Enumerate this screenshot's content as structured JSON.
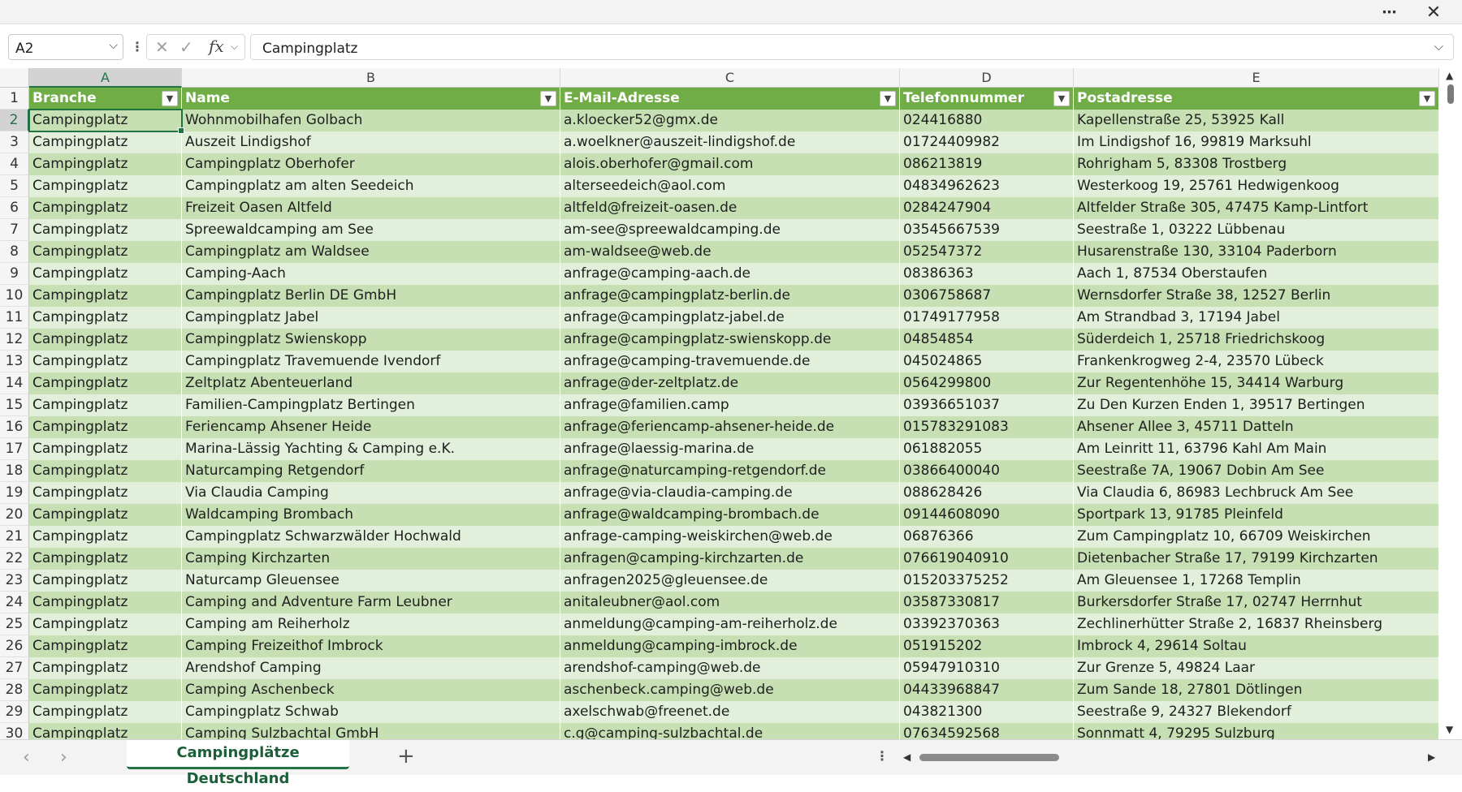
{
  "window": {
    "more_icon": "⋯",
    "close_icon": "✕"
  },
  "formula_bar": {
    "name_box": "A2",
    "formula": "Campingplatz",
    "fx_label": "fx"
  },
  "columns": [
    "A",
    "B",
    "C",
    "D",
    "E"
  ],
  "header_row": [
    "Branche",
    "Name",
    "E-Mail-Adresse",
    "Telefonnummer",
    "Postadresse"
  ],
  "rows": [
    {
      "n": "2",
      "cells": [
        "Campingplatz",
        "Wohnmobilhafen Golbach",
        "a.kloecker52@gmx.de",
        "024416880",
        "Kapellenstraße 25, 53925 Kall"
      ]
    },
    {
      "n": "3",
      "cells": [
        "Campingplatz",
        "Auszeit Lindigshof",
        "a.woelkner@auszeit-lindigshof.de",
        "01724409982",
        "Im Lindigshof 16, 99819 Marksuhl"
      ]
    },
    {
      "n": "4",
      "cells": [
        "Campingplatz",
        "Campingplatz Oberhofer",
        "alois.oberhofer@gmail.com",
        "086213819",
        "Rohrigham 5, 83308 Trostberg"
      ]
    },
    {
      "n": "5",
      "cells": [
        "Campingplatz",
        "Campingplatz am alten Seedeich",
        "alterseedeich@aol.com",
        "04834962623",
        "Westerkoog 19, 25761 Hedwigenkoog"
      ]
    },
    {
      "n": "6",
      "cells": [
        "Campingplatz",
        "Freizeit Oasen Altfeld",
        "altfeld@freizeit-oasen.de",
        "0284247904",
        "Altfelder Straße 305, 47475 Kamp-Lintfort"
      ]
    },
    {
      "n": "7",
      "cells": [
        "Campingplatz",
        "Spreewaldcamping am See",
        "am-see@spreewaldcamping.de",
        "03545667539",
        "Seestraße 1, 03222 Lübbenau"
      ]
    },
    {
      "n": "8",
      "cells": [
        "Campingplatz",
        "Campingplatz am Waldsee",
        "am-waldsee@web.de",
        "052547372",
        "Husarenstraße 130, 33104 Paderborn"
      ]
    },
    {
      "n": "9",
      "cells": [
        "Campingplatz",
        "Camping-Aach",
        "anfrage@camping-aach.de",
        "08386363",
        "Aach 1, 87534 Oberstaufen"
      ]
    },
    {
      "n": "10",
      "cells": [
        "Campingplatz",
        "Campingplatz Berlin DE GmbH",
        "anfrage@campingplatz-berlin.de",
        "0306758687",
        "Wernsdorfer Straße 38, 12527 Berlin"
      ]
    },
    {
      "n": "11",
      "cells": [
        "Campingplatz",
        "Campingplatz Jabel",
        "anfrage@campingplatz-jabel.de",
        "01749177958",
        "Am Strandbad 3, 17194 Jabel"
      ]
    },
    {
      "n": "12",
      "cells": [
        "Campingplatz",
        "Campingplatz Swienskopp",
        "anfrage@campingplatz-swienskopp.de",
        "04854854",
        "Süderdeich 1, 25718 Friedrichskoog"
      ]
    },
    {
      "n": "13",
      "cells": [
        "Campingplatz",
        "Campingplatz Travemuende Ivendorf",
        "anfrage@camping-travemuende.de",
        "045024865",
        "Frankenkrogweg 2-4, 23570 Lübeck"
      ]
    },
    {
      "n": "14",
      "cells": [
        "Campingplatz",
        "Zeltplatz Abenteuerland",
        "anfrage@der-zeltplatz.de",
        "0564299800",
        "Zur Regentenhöhe 15, 34414 Warburg"
      ]
    },
    {
      "n": "15",
      "cells": [
        "Campingplatz",
        "Familien-Campingplatz Bertingen",
        "anfrage@familien.camp",
        "03936651037",
        "Zu Den Kurzen Enden 1, 39517 Bertingen"
      ]
    },
    {
      "n": "16",
      "cells": [
        "Campingplatz",
        "Feriencamp Ahsener Heide",
        "anfrage@feriencamp-ahsener-heide.de",
        "015783291083",
        "Ahsener Allee 3, 45711 Datteln"
      ]
    },
    {
      "n": "17",
      "cells": [
        "Campingplatz",
        "Marina-Lässig Yachting & Camping e.K.",
        "anfrage@laessig-marina.de",
        "061882055",
        "Am Leinritt 11, 63796 Kahl Am Main"
      ]
    },
    {
      "n": "18",
      "cells": [
        "Campingplatz",
        "Naturcamping Retgendorf",
        "anfrage@naturcamping-retgendorf.de",
        "03866400040",
        "Seestraße 7A, 19067 Dobin Am See"
      ]
    },
    {
      "n": "19",
      "cells": [
        "Campingplatz",
        "Via Claudia Camping",
        "anfrage@via-claudia-camping.de",
        "088628426",
        "Via Claudia 6, 86983 Lechbruck Am See"
      ]
    },
    {
      "n": "20",
      "cells": [
        "Campingplatz",
        "Waldcamping Brombach",
        "anfrage@waldcamping-brombach.de",
        "09144608090",
        "Sportpark 13, 91785 Pleinfeld"
      ]
    },
    {
      "n": "21",
      "cells": [
        "Campingplatz",
        "Campingplatz Schwarzwälder Hochwald",
        "anfrage-camping-weiskirchen@web.de",
        "06876366",
        "Zum Campingplatz 10, 66709 Weiskirchen"
      ]
    },
    {
      "n": "22",
      "cells": [
        "Campingplatz",
        "Camping Kirchzarten",
        "anfragen@camping-kirchzarten.de",
        "076619040910",
        "Dietenbacher Straße 17, 79199 Kirchzarten"
      ]
    },
    {
      "n": "23",
      "cells": [
        "Campingplatz",
        "Naturcamp Gleuensee",
        "anfragen2025@gleuensee.de",
        "015203375252",
        "Am Gleuensee 1, 17268 Templin"
      ]
    },
    {
      "n": "24",
      "cells": [
        "Campingplatz",
        "Camping and Adventure Farm Leubner",
        "anitaleubner@aol.com",
        "03587330817",
        "Burkersdorfer Straße 17, 02747 Herrnhut"
      ]
    },
    {
      "n": "25",
      "cells": [
        "Campingplatz",
        "Camping am Reiherholz",
        "anmeldung@camping-am-reiherholz.de",
        "03392370363",
        "Zechlinerhütter Straße 2, 16837 Rheinsberg"
      ]
    },
    {
      "n": "26",
      "cells": [
        "Campingplatz",
        "Camping Freizeithof Imbrock",
        "anmeldung@camping-imbrock.de",
        "051915202",
        "Imbrock 4, 29614 Soltau"
      ]
    },
    {
      "n": "27",
      "cells": [
        "Campingplatz",
        "Arendshof Camping",
        "arendshof-camping@web.de",
        "05947910310",
        "Zur Grenze 5, 49824 Laar"
      ]
    },
    {
      "n": "28",
      "cells": [
        "Campingplatz",
        "Camping Aschenbeck",
        "aschenbeck.camping@web.de",
        "04433968847",
        "Zum Sande 18, 27801 Dötlingen"
      ]
    },
    {
      "n": "29",
      "cells": [
        "Campingplatz",
        "Campingplatz Schwab",
        "axelschwab@freenet.de",
        "043821300",
        "Seestraße 9, 24327 Blekendorf"
      ]
    },
    {
      "n": "30",
      "cells": [
        "Campingplatz",
        "Camping Sulzbachtal GmbH",
        "c.g@camping-sulzbachtal.de",
        "07634592568",
        "Sonnmatt 4, 79295 Sulzburg"
      ]
    }
  ],
  "sheet_tabs": [
    {
      "label": "Campingplätze Deutschland",
      "active": true
    }
  ],
  "icons": {
    "filter": "filter-dropdown-icon",
    "add_sheet": "plus-icon",
    "nav_prev": "chevron-left-icon",
    "nav_next": "chevron-right-icon"
  },
  "colors": {
    "header_bg": "#70ad47",
    "band_dark": "#c6e0b4",
    "band_light": "#e2efda",
    "accent": "#217346"
  }
}
